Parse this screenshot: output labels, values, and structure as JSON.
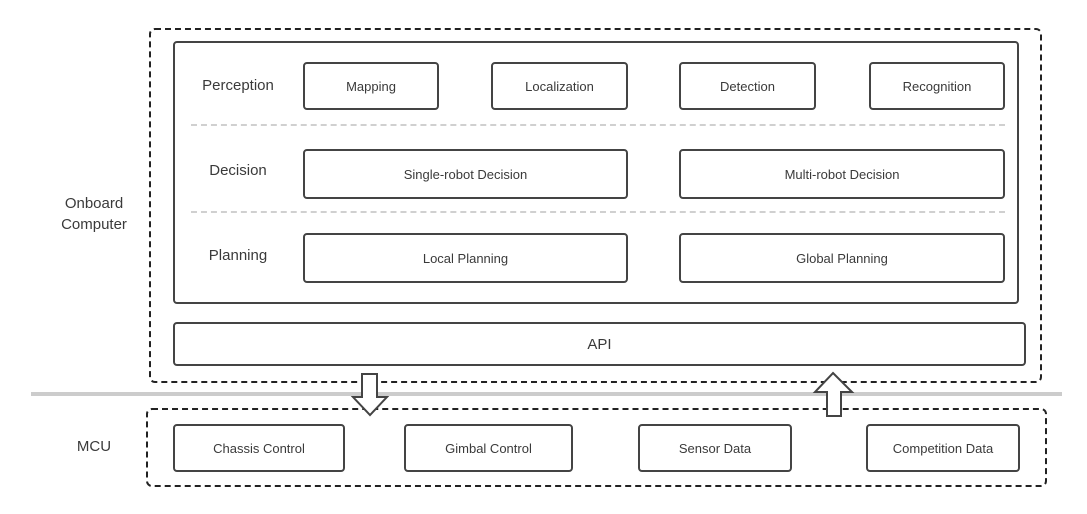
{
  "onboard": {
    "label": "Onboard\nComputer",
    "layers": [
      {
        "label": "Perception",
        "modules": [
          "Mapping",
          "Localization",
          "Detection",
          "Recognition"
        ]
      },
      {
        "label": "Decision",
        "modules": [
          "Single-robot Decision",
          "Multi-robot Decision"
        ]
      },
      {
        "label": "Planning",
        "modules": [
          "Local Planning",
          "Global Planning"
        ]
      }
    ],
    "api_label": "API"
  },
  "mcu": {
    "label": "MCU",
    "modules": [
      "Chassis Control",
      "Gimbal Control",
      "Sensor Data",
      "Competition Data"
    ]
  },
  "arrows": [
    {
      "direction": "down",
      "from": "Onboard Computer",
      "to": "MCU"
    },
    {
      "direction": "up",
      "from": "MCU",
      "to": "Onboard Computer"
    }
  ],
  "colors": {
    "box_border": "#444444",
    "dashed_border": "#222222",
    "layer_separator": "#d0d0d0",
    "tier_divider": "#cccccc"
  }
}
